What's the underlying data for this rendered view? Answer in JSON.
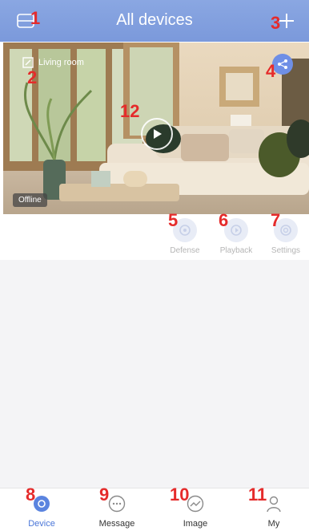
{
  "header": {
    "title": "All devices",
    "left_icon": "scan-icon",
    "right_icon": "plus-icon"
  },
  "camera": {
    "room_label": "Living room",
    "status": "Offline",
    "share_icon": "share-icon",
    "play_icon": "play-icon"
  },
  "actions": [
    {
      "label": "Defense",
      "icon": "defense-icon"
    },
    {
      "label": "Playback",
      "icon": "playback-icon"
    },
    {
      "label": "Settings",
      "icon": "settings-icon"
    }
  ],
  "tabs": [
    {
      "label": "Device",
      "icon": "device-icon",
      "active": true
    },
    {
      "label": "Message",
      "icon": "message-icon",
      "active": false
    },
    {
      "label": "Image",
      "icon": "image-icon",
      "active": false
    },
    {
      "label": "My",
      "icon": "user-icon",
      "active": false
    }
  ],
  "markers": [
    "1",
    "2",
    "3",
    "4",
    "5",
    "6",
    "7",
    "8",
    "9",
    "10",
    "11",
    "12"
  ],
  "colors": {
    "header": "#7b99db",
    "accent": "#4a76d8",
    "marker": "#e52b2b"
  }
}
